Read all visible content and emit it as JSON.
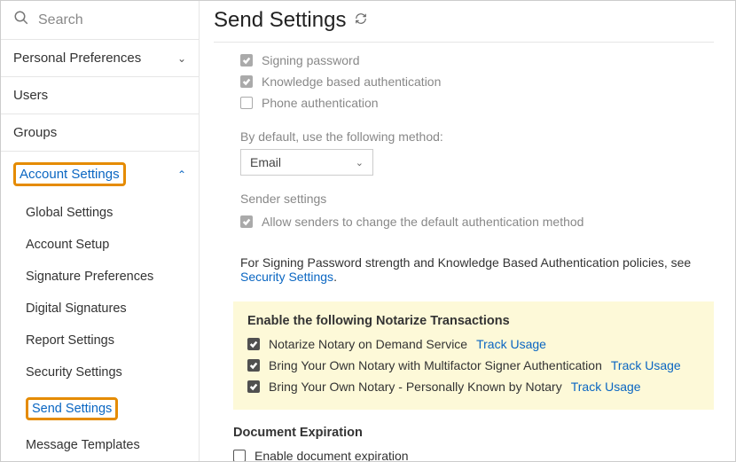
{
  "search": {
    "placeholder": "Search"
  },
  "sidebar": {
    "personal_prefs": "Personal Preferences",
    "users": "Users",
    "groups": "Groups",
    "account_settings": "Account Settings",
    "sub": {
      "global": "Global Settings",
      "setup": "Account Setup",
      "sigprefs": "Signature Preferences",
      "digsig": "Digital Signatures",
      "report": "Report Settings",
      "security": "Security Settings",
      "send": "Send Settings",
      "templates": "Message Templates"
    }
  },
  "page": {
    "title": "Send Settings"
  },
  "auth": {
    "signing_password": "Signing password",
    "kba": "Knowledge based authentication",
    "phone": "Phone authentication",
    "default_method_label": "By default, use the following method:",
    "default_method_value": "Email",
    "sender_settings_label": "Sender settings",
    "allow_change": "Allow senders to change the default authentication method"
  },
  "info": {
    "text_prefix": "For Signing Password strength and Knowledge Based Authentication policies, see ",
    "link": "Security Settings",
    "suffix": "."
  },
  "notarize": {
    "heading": "Enable the following Notarize Transactions",
    "row1_label": "Notarize Notary on Demand Service",
    "row2_label": "Bring Your Own Notary with Multifactor Signer Authentication",
    "row3_label": "Bring Your Own Notary - Personally Known by Notary",
    "track_usage": "Track Usage"
  },
  "expiration": {
    "heading": "Document Expiration",
    "enable": "Enable document expiration"
  }
}
